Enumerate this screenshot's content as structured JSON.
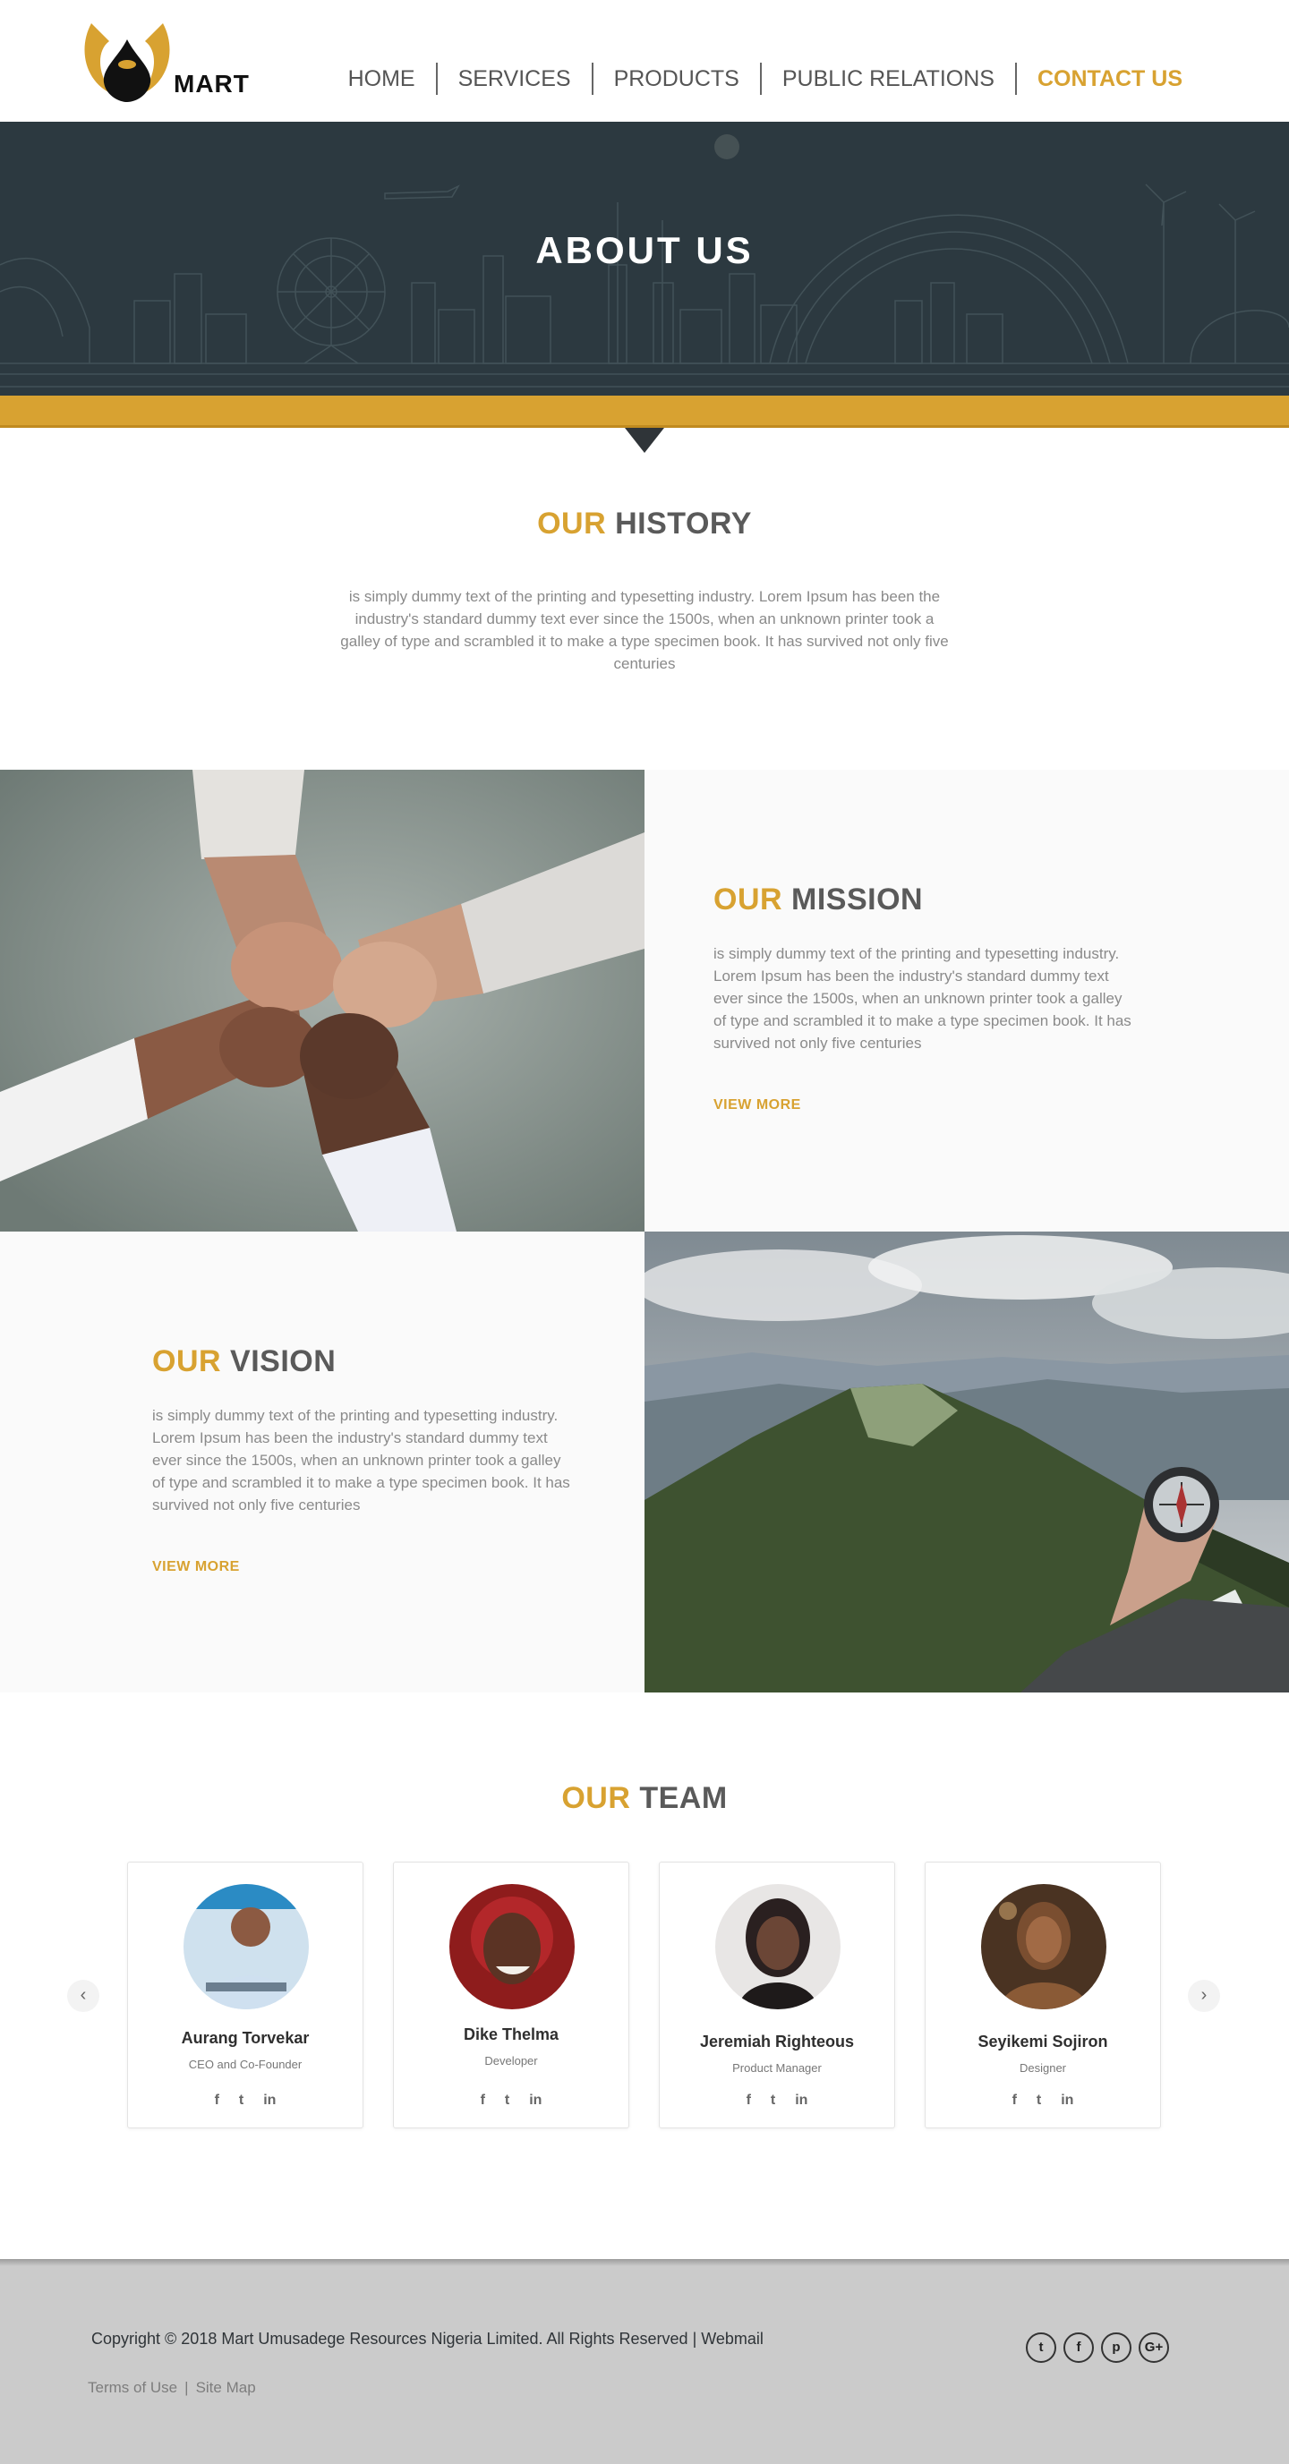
{
  "brand": {
    "name": "MART",
    "accent": "#d8a231",
    "dark": "#2c3940"
  },
  "nav": {
    "items": [
      {
        "label": "HOME"
      },
      {
        "label": "SERVICES"
      },
      {
        "label": "PRODUCTS"
      },
      {
        "label": "PUBLIC RELATIONS"
      },
      {
        "label": "CONTACT US",
        "active": true
      }
    ]
  },
  "hero": {
    "title": "ABOUT US"
  },
  "history": {
    "title_accent": "OUR",
    "title_rest": "HISTORY",
    "text": "is simply dummy text of the printing and typesetting industry. Lorem Ipsum has been the industry's standard dummy text ever since the 1500s, when an unknown printer took a galley of type and scrambled it to make a type specimen book. It has survived not only five centuries"
  },
  "mission": {
    "title_accent": "OUR",
    "title_rest": "MISSION",
    "text": "is simply dummy text of the printing and typesetting industry. Lorem Ipsum has been the industry's standard dummy text ever since the 1500s, when an unknown printer took a galley of type and scrambled it to make a type specimen book. It has survived not only five centuries",
    "link": "VIEW MORE"
  },
  "vision": {
    "title_accent": "OUR",
    "title_rest": "VISION",
    "text": "is simply dummy text of the printing and typesetting industry. Lorem Ipsum has been the industry's standard dummy text ever since the 1500s, when an unknown printer took a galley of type and scrambled it to make a type specimen book. It has survived not only five centuries",
    "link": "VIEW MORE"
  },
  "team": {
    "title_accent": "OUR",
    "title_rest": "TEAM",
    "prev_icon": "‹",
    "next_icon": "›",
    "members": [
      {
        "name": "Aurang Torvekar",
        "role": "CEO and Co-Founder"
      },
      {
        "name": "Dike Thelma",
        "role": "Developer"
      },
      {
        "name": "Jeremiah Righteous",
        "role": "Product Manager"
      },
      {
        "name": "Seyikemi Sojiron",
        "role": "Designer"
      }
    ],
    "social_icons": [
      "facebook-icon",
      "twitter-icon",
      "linkedin-icon"
    ]
  },
  "footer": {
    "copyright": "Copyright © 2018 Mart Umusadege Resources Nigeria Limited. All Rights Reserved | Webmail",
    "links": [
      "Terms of Use",
      "Site Map"
    ],
    "link_separator": "|",
    "social_icons": [
      "twitter-icon",
      "facebook-icon",
      "pinterest-icon",
      "google-plus-icon"
    ]
  }
}
